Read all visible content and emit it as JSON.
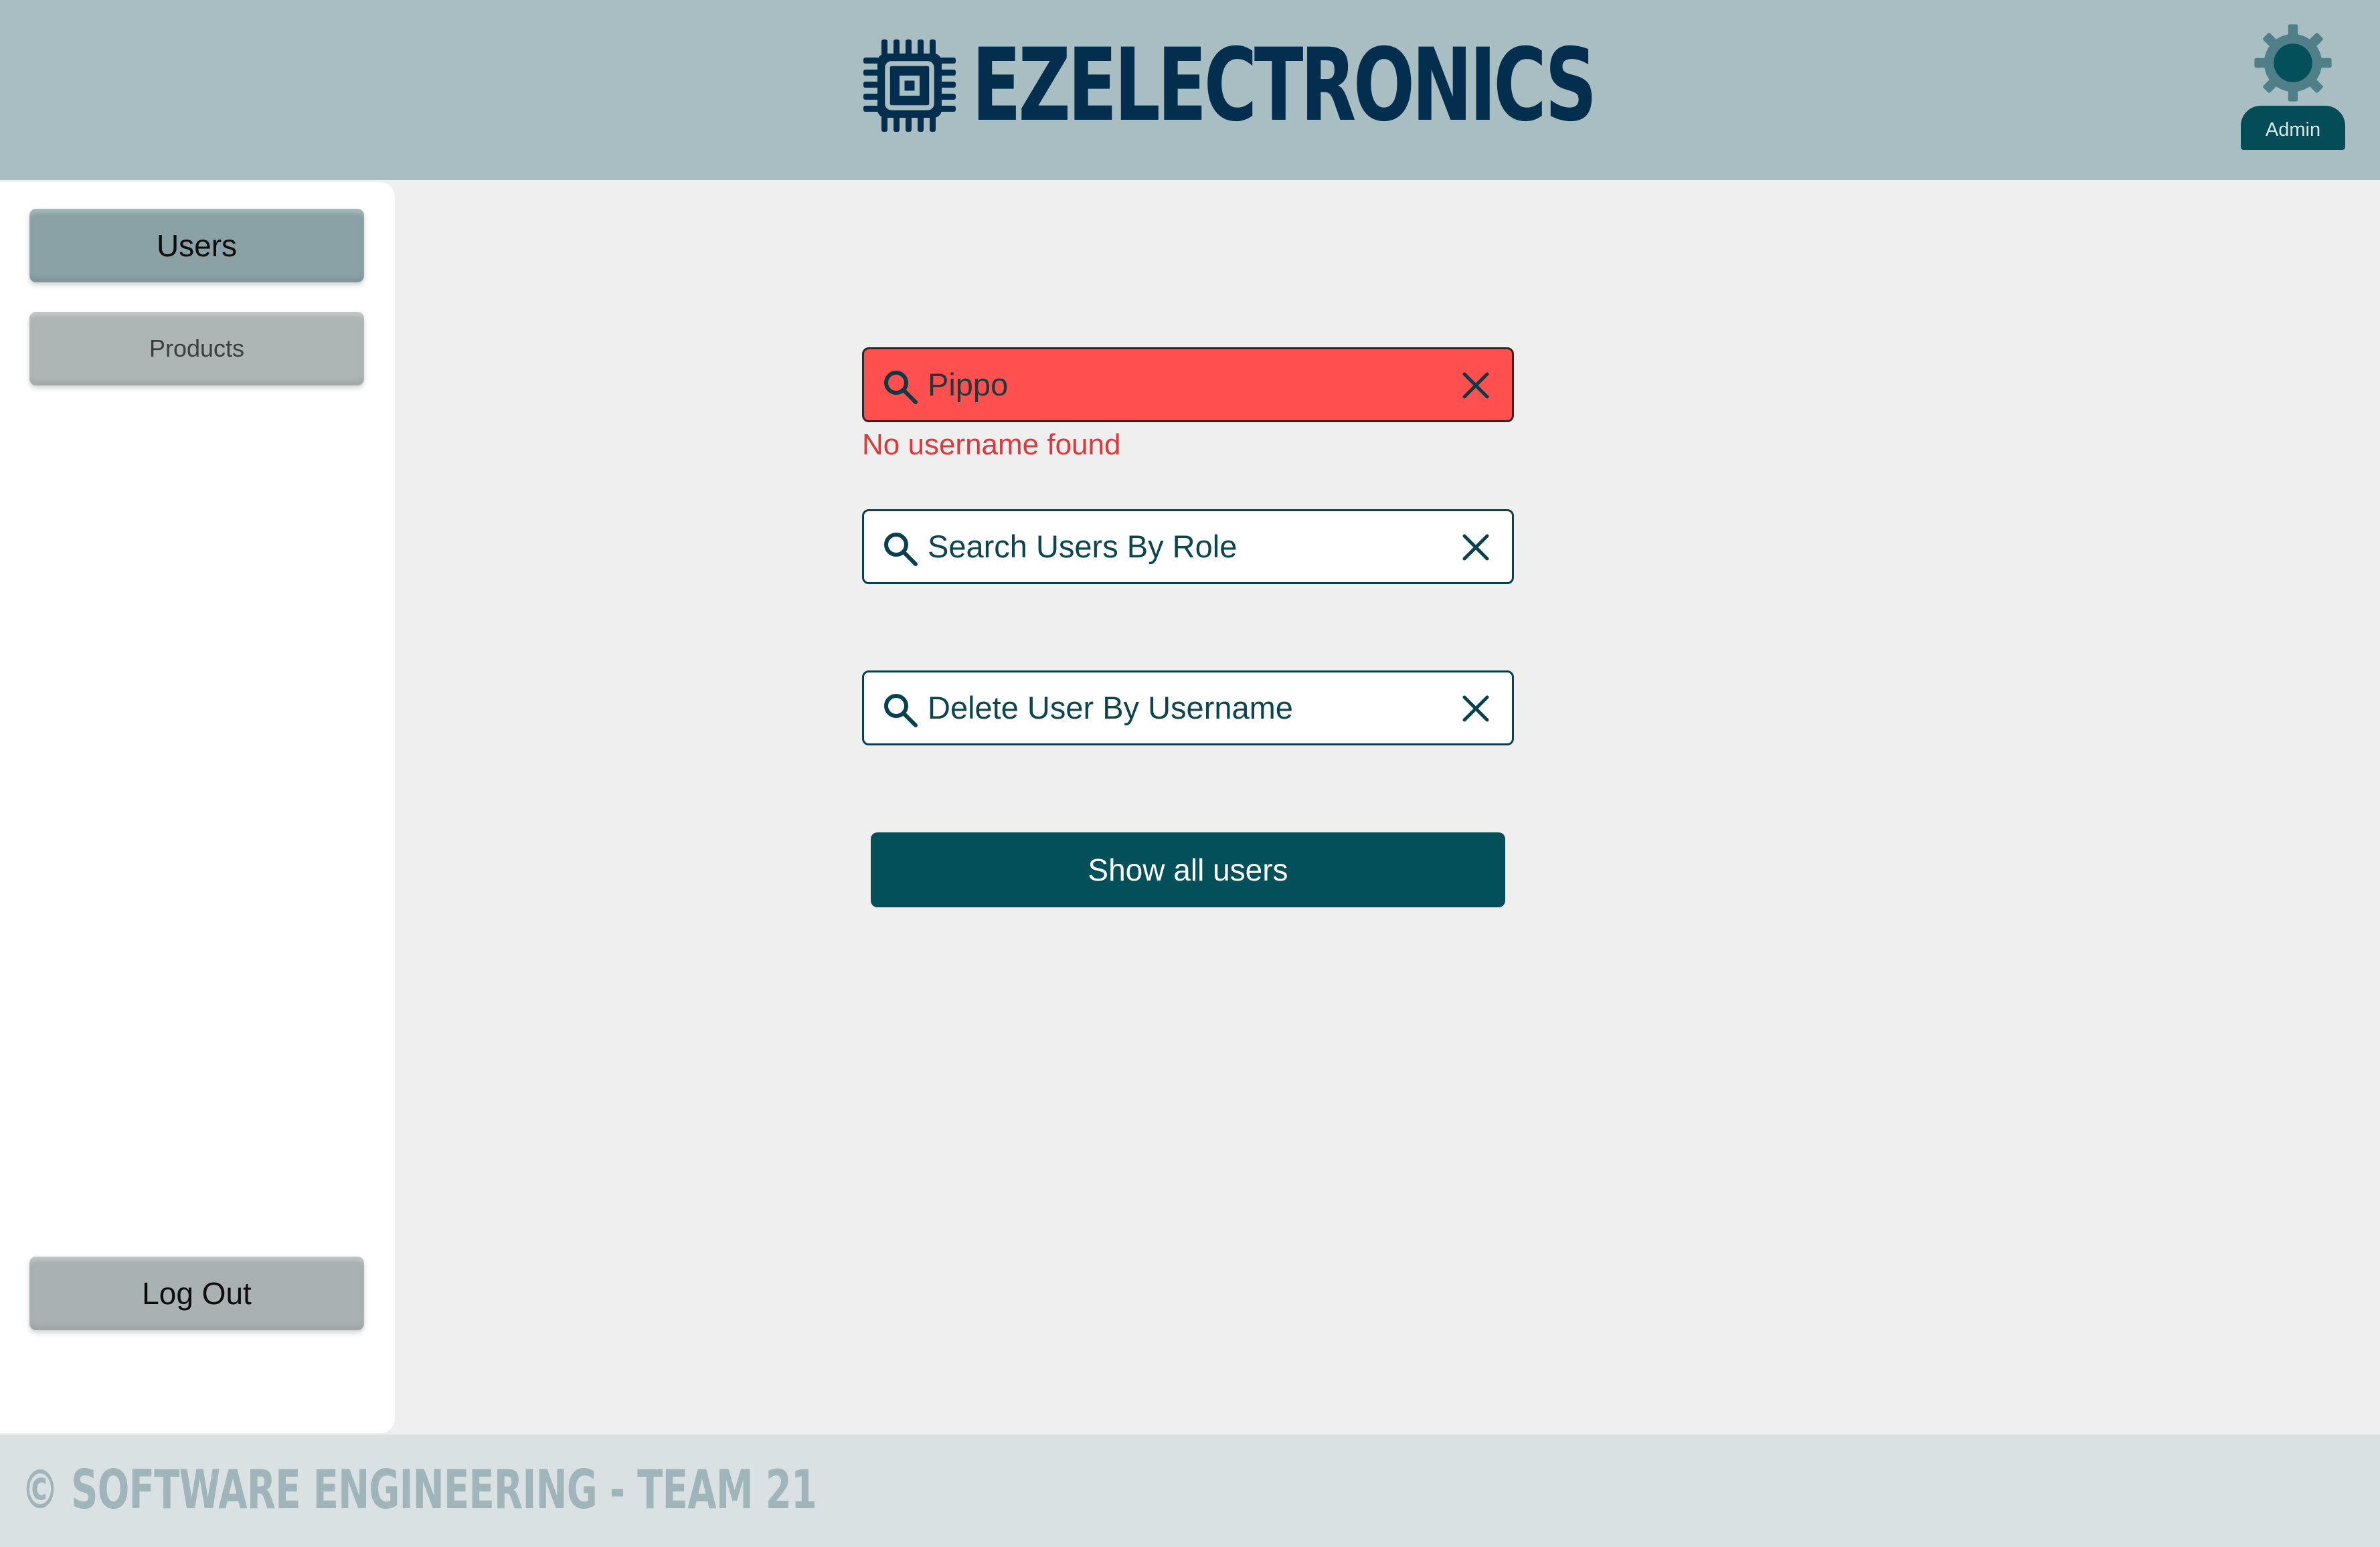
{
  "header": {
    "brand_name": "EZELECTRONICS",
    "logo_icon": "chip-icon",
    "user_icon": "gear-icon",
    "user_role": "Admin"
  },
  "sidebar": {
    "items": [
      {
        "label": "Users",
        "active": true
      },
      {
        "label": "Products",
        "active": false
      }
    ],
    "logout_label": "Log Out"
  },
  "main": {
    "search_username": {
      "value": "Pippo",
      "state": "error",
      "error_message": "No username found",
      "icon": "search-icon",
      "clear_icon": "close-icon"
    },
    "search_role": {
      "placeholder": "Search Users By Role",
      "value": "",
      "icon": "search-icon",
      "clear_icon": "close-icon"
    },
    "delete_user": {
      "placeholder": "Delete User By Username",
      "value": "",
      "icon": "search-icon",
      "clear_icon": "close-icon"
    },
    "show_all_label": "Show all users"
  },
  "footer": {
    "text": "© SOFTWARE ENGINEERING - TEAM 21"
  },
  "colors": {
    "header_bg": "#a9bec3",
    "brand": "#032e4e",
    "accent": "#034f5a",
    "error_field": "#ff4f4f",
    "error_text": "#d93b3b",
    "page_bg": "#efefef",
    "footer_bg": "#d9e1e2"
  }
}
